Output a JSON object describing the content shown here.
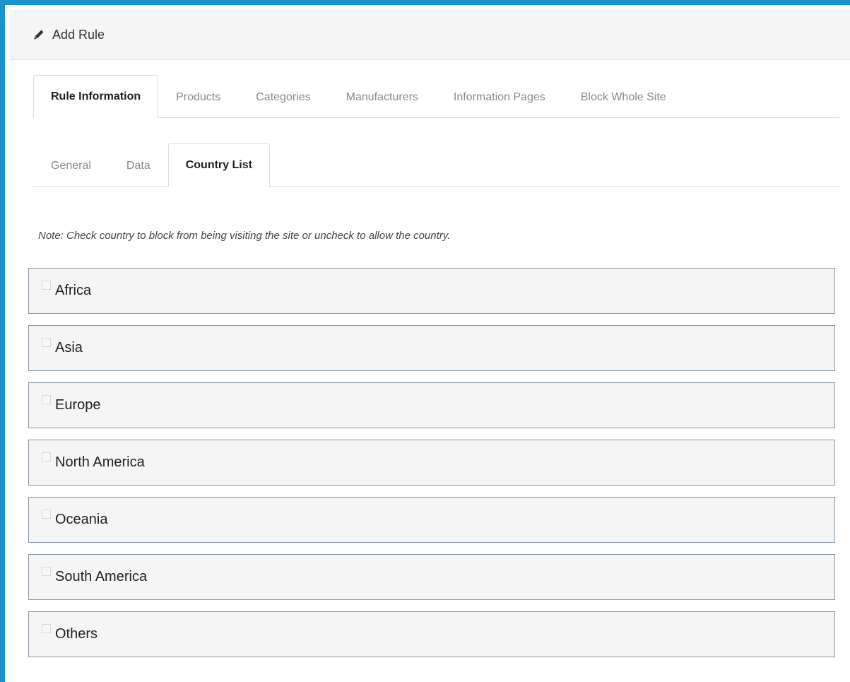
{
  "header": {
    "title": "Add Rule",
    "icon": "pencil-icon"
  },
  "main_tabs": [
    {
      "label": "Rule Information",
      "active": true
    },
    {
      "label": "Products",
      "active": false
    },
    {
      "label": "Categories",
      "active": false
    },
    {
      "label": "Manufacturers",
      "active": false
    },
    {
      "label": "Information Pages",
      "active": false
    },
    {
      "label": "Block Whole Site",
      "active": false
    }
  ],
  "sub_tabs": [
    {
      "label": "General",
      "active": false
    },
    {
      "label": "Data",
      "active": false
    },
    {
      "label": "Country List",
      "active": true
    }
  ],
  "note": "Note: Check country to block from being visiting the site or uncheck to allow the country.",
  "regions": [
    {
      "label": "Africa",
      "checked": false
    },
    {
      "label": "Asia",
      "checked": false
    },
    {
      "label": "Europe",
      "checked": false
    },
    {
      "label": "North America",
      "checked": false
    },
    {
      "label": "Oceania",
      "checked": false
    },
    {
      "label": "South America",
      "checked": false
    },
    {
      "label": "Others",
      "checked": false
    }
  ],
  "colors": {
    "accent": "#1e91cf",
    "panel_bg": "#f5f5f5",
    "region_border": "#8795a1"
  }
}
